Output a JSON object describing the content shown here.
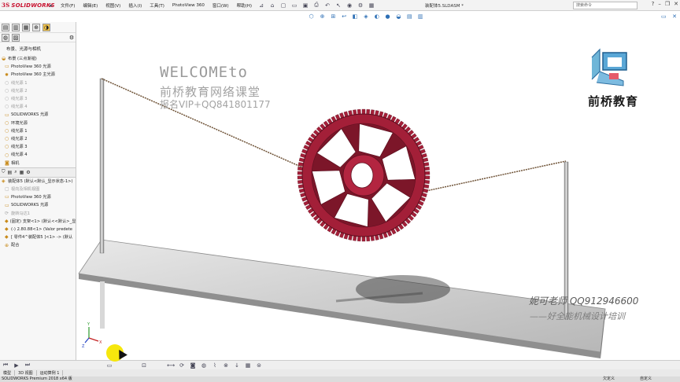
{
  "app": {
    "brand": "SOLIDWORKS",
    "document_title": "装配体5.SLDASM *",
    "search_placeholder": "搜索命令"
  },
  "menu": [
    "文件(F)",
    "编辑(E)",
    "视图(V)",
    "插入(I)",
    "工具(T)",
    "PhotoView 360",
    "窗口(W)",
    "帮助(H)"
  ],
  "panel": {
    "header": "布景、光源与相机",
    "tree": [
      {
        "label": "布景 (三点渐褪)",
        "dim": false,
        "icon": "scene-icon"
      },
      {
        "label": "PhotoView 360 光源",
        "dim": false,
        "icon": "folder-icon"
      },
      {
        "label": "PhotoView 360 主光源",
        "dim": false,
        "icon": "light-icon"
      },
      {
        "label": "线光源 1",
        "dim": true,
        "icon": "bulb-icon"
      },
      {
        "label": "线光源 2",
        "dim": true,
        "icon": "bulb-icon"
      },
      {
        "label": "线光源 3",
        "dim": true,
        "icon": "bulb-icon"
      },
      {
        "label": "线光源 4",
        "dim": true,
        "icon": "bulb-icon"
      },
      {
        "label": "SOLIDWORKS 光源",
        "dim": false,
        "icon": "folder-icon"
      },
      {
        "label": "环境光源",
        "dim": false,
        "icon": "bulb-icon"
      },
      {
        "label": "线光源 1",
        "dim": false,
        "icon": "bulb-icon"
      },
      {
        "label": "线光源 2",
        "dim": false,
        "icon": "bulb-icon"
      },
      {
        "label": "线光源 3",
        "dim": false,
        "icon": "bulb-icon"
      },
      {
        "label": "线光源 4",
        "dim": false,
        "icon": "bulb-icon"
      },
      {
        "label": "相机",
        "dim": false,
        "icon": "camera-icon"
      }
    ],
    "tree2": [
      {
        "label": "装配体5 (默认<默认_显示状态-1>)",
        "dim": false,
        "icon": "assembly-icon"
      },
      {
        "label": "视向及相机视图",
        "dim": true,
        "icon": "view-icon"
      },
      {
        "label": "PhotoView 360 光源",
        "dim": false,
        "icon": "folder-icon"
      },
      {
        "label": "SOLIDWORKS 光源",
        "dim": false,
        "icon": "folder-icon"
      },
      {
        "label": "旋转马达1",
        "dim": true,
        "icon": "motor-icon"
      },
      {
        "label": "(固定) 支架<1> (默认<<默认>_显",
        "dim": false,
        "icon": "part-icon"
      },
      {
        "label": "(-) 2.80.88<1> (Valor predete",
        "dim": false,
        "icon": "part-icon"
      },
      {
        "label": "[ 零件4^装配体5 ]<1> -> (默认",
        "dim": false,
        "icon": "part-icon"
      },
      {
        "label": "配合",
        "dim": false,
        "icon": "mate-icon"
      }
    ]
  },
  "overlay": {
    "welcome": "WELCOMEto",
    "school": "前桥教育网络课堂",
    "signup": "报名VIP+QQ841801177",
    "brand": "前桥教育",
    "teacher": "妮可老师 QQ912946600",
    "course": "——好全能机械设计培训"
  },
  "bottom": {
    "tabs": [
      "模型",
      "3D 视图",
      "运动算例 1"
    ],
    "status_left": "SOLIDWORKS Premium 2018 x64 版",
    "status_mid": "欠定义",
    "status_right": "自定义"
  },
  "colors": {
    "gear": "#a31f38",
    "rope": "#7a5a3a",
    "base": "#c9c9c9",
    "accent": "#c8102e"
  }
}
